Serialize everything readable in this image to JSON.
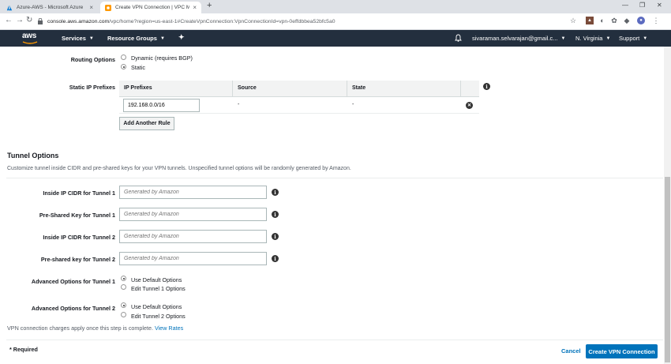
{
  "browser": {
    "tabs": [
      {
        "title": "Azure-AWS - Microsoft Azure",
        "icon": "azure-favicon"
      },
      {
        "title": "Create VPN Connection | VPC M...",
        "icon": "aws-favicon"
      }
    ],
    "url_host": "console.aws.amazon.com",
    "url_path": "/vpc/home?region=us-east-1#CreateVpnConnection:VpnConnectionId=vpn-0effdbbea52bfc5a0"
  },
  "aws_nav": {
    "logo": "aws",
    "services": "Services",
    "resource_groups": "Resource Groups",
    "user": "sivaraman.selvarajan@gmail.c...",
    "region": "N. Virginia",
    "support": "Support"
  },
  "routing": {
    "label": "Routing Options",
    "options": [
      {
        "label": "Dynamic (requires BGP)",
        "selected": false
      },
      {
        "label": "Static",
        "selected": true
      }
    ]
  },
  "static_prefixes": {
    "label": "Static IP Prefixes",
    "columns": [
      "IP Prefixes",
      "Source",
      "State"
    ],
    "rows": [
      {
        "prefix": "192.168.0.0/16",
        "source": "-",
        "state": "-"
      }
    ],
    "add_rule": "Add Another Rule"
  },
  "tunnel": {
    "title": "Tunnel Options",
    "description": "Customize tunnel inside CIDR and pre-shared keys for your VPN tunnels. Unspecified tunnel options will be randomly generated by Amazon.",
    "fields": [
      {
        "label": "Inside IP CIDR for Tunnel 1",
        "placeholder": "Generated by Amazon"
      },
      {
        "label": "Pre-Shared Key for Tunnel 1",
        "placeholder": "Generated by Amazon"
      },
      {
        "label": "Inside IP CIDR for Tunnel 2",
        "placeholder": "Generated by Amazon"
      },
      {
        "label": "Pre-shared key for Tunnel 2",
        "placeholder": "Generated by Amazon"
      }
    ],
    "advanced1": {
      "label": "Advanced Options for Tunnel 1",
      "options": [
        "Use Default Options",
        "Edit Tunnel 1 Options"
      ]
    },
    "advanced2": {
      "label": "Advanced Options for Tunnel 2",
      "options": [
        "Use Default Options",
        "Edit Tunnel 2 Options"
      ]
    }
  },
  "footer": {
    "charges_note": "VPN connection charges apply once this step is complete.",
    "view_rates": "View Rates",
    "required": "* Required",
    "cancel": "Cancel",
    "create": "Create VPN Connection"
  },
  "colors": {
    "aws_nav_bg": "#232f3e",
    "primary": "#0073bb",
    "aws_orange": "#ff9900"
  }
}
